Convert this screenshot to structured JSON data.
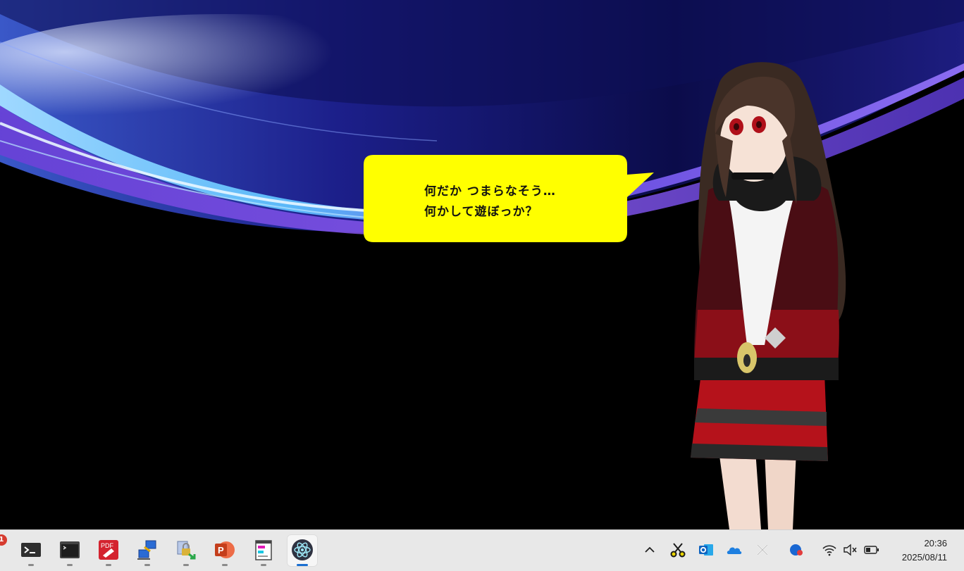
{
  "bubble": {
    "line1": "何だか つまらなそう…",
    "line2": "何かして遊ぼっか？"
  },
  "taskbar": {
    "notification_badge": "1",
    "apps": [
      {
        "name": "terminal",
        "icon": "terminal-icon"
      },
      {
        "name": "console",
        "icon": "console-icon"
      },
      {
        "name": "pdf-editor",
        "icon": "pdf-icon",
        "label": "PDF"
      },
      {
        "name": "network",
        "icon": "network-icon"
      },
      {
        "name": "lock-transfer",
        "icon": "lock-transfer-icon"
      },
      {
        "name": "powerpoint",
        "icon": "powerpoint-icon",
        "label": "P"
      },
      {
        "name": "notepad",
        "icon": "notepad-icon"
      },
      {
        "name": "electron",
        "icon": "electron-icon",
        "active": true
      }
    ]
  },
  "tray": {
    "icons": [
      "chevron-up-icon",
      "snipping-icon",
      "outlook-icon",
      "onedrive-icon",
      "x-icon",
      "copilot-icon",
      "wifi-icon",
      "volume-muted-icon",
      "battery-icon"
    ]
  },
  "clock": {
    "time": "20:36",
    "date": "2025/08/11"
  },
  "colors": {
    "bubble": "#ffff00",
    "taskbar": "#e8e8e8",
    "active_indicator": "#1a6fd1"
  }
}
